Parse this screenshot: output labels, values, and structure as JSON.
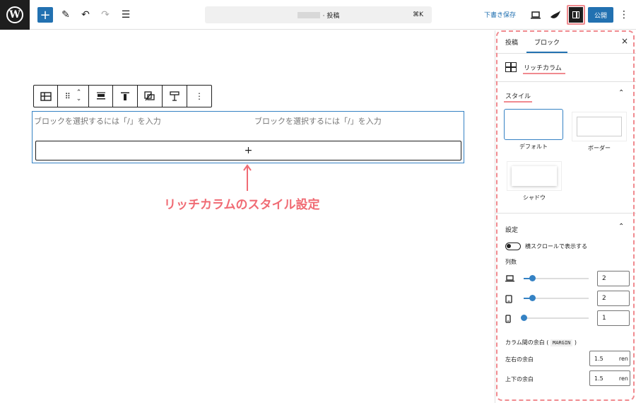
{
  "topbar": {
    "logo": "W",
    "add_label": "+",
    "search_title": "· 投稿",
    "search_shortcut": "⌘K",
    "draft_label": "下書き保存",
    "publish_label": "公開",
    "icons": [
      "wordpress-icon",
      "plus-icon",
      "pen-icon",
      "undo-icon",
      "redo-icon",
      "list-view-icon",
      "desktop-view-icon",
      "theme-icon",
      "sidebar-toggle-icon",
      "more-vertical-icon"
    ]
  },
  "editor": {
    "toolbar_items": [
      "columns-icon",
      "drag-icon",
      "move-icon",
      "align-icon",
      "vertical-align-icon",
      "style-icon",
      "width-icon",
      "more-icon"
    ],
    "columns": [
      {
        "placeholder": "ブロックを選択するには「/」を入力"
      },
      {
        "placeholder": "ブロックを選択するには「/」を入力"
      }
    ],
    "appender_label": "+",
    "annotation": "リッチカラムのスタイル設定"
  },
  "sidebar": {
    "tabs": [
      {
        "label": "投稿"
      },
      {
        "label": "ブロック"
      }
    ],
    "active_tab": "ブロック",
    "close_label": "×",
    "block_name": "リッチカラム",
    "styles_title": "スタイル",
    "styles": [
      {
        "label": "デフォルト"
      },
      {
        "label": "ボーダー"
      },
      {
        "label": "シャドウ"
      }
    ],
    "selected_style": "デフォルト",
    "settings_title": "設定",
    "toggle_label": "横スクロールで表示する",
    "columns_label": "列数",
    "column_counts": [
      {
        "device": "desktop-icon",
        "value": "2",
        "level": 0.15
      },
      {
        "device": "tablet-icon",
        "value": "2",
        "level": 0.15
      },
      {
        "device": "mobile-icon",
        "value": "1",
        "level": 0.0
      }
    ],
    "margin_label": "カラム間の余白 (",
    "margin_code": "MARGIN",
    "margin_close": ")",
    "lr_label": "左右の余白",
    "lr_value": "1.5",
    "lr_unit": "ren",
    "tb_label": "上下の余白",
    "tb_value": "1.5",
    "tb_unit": "ren",
    "accent": "#2271b1",
    "highlight": "#f08a8f"
  }
}
